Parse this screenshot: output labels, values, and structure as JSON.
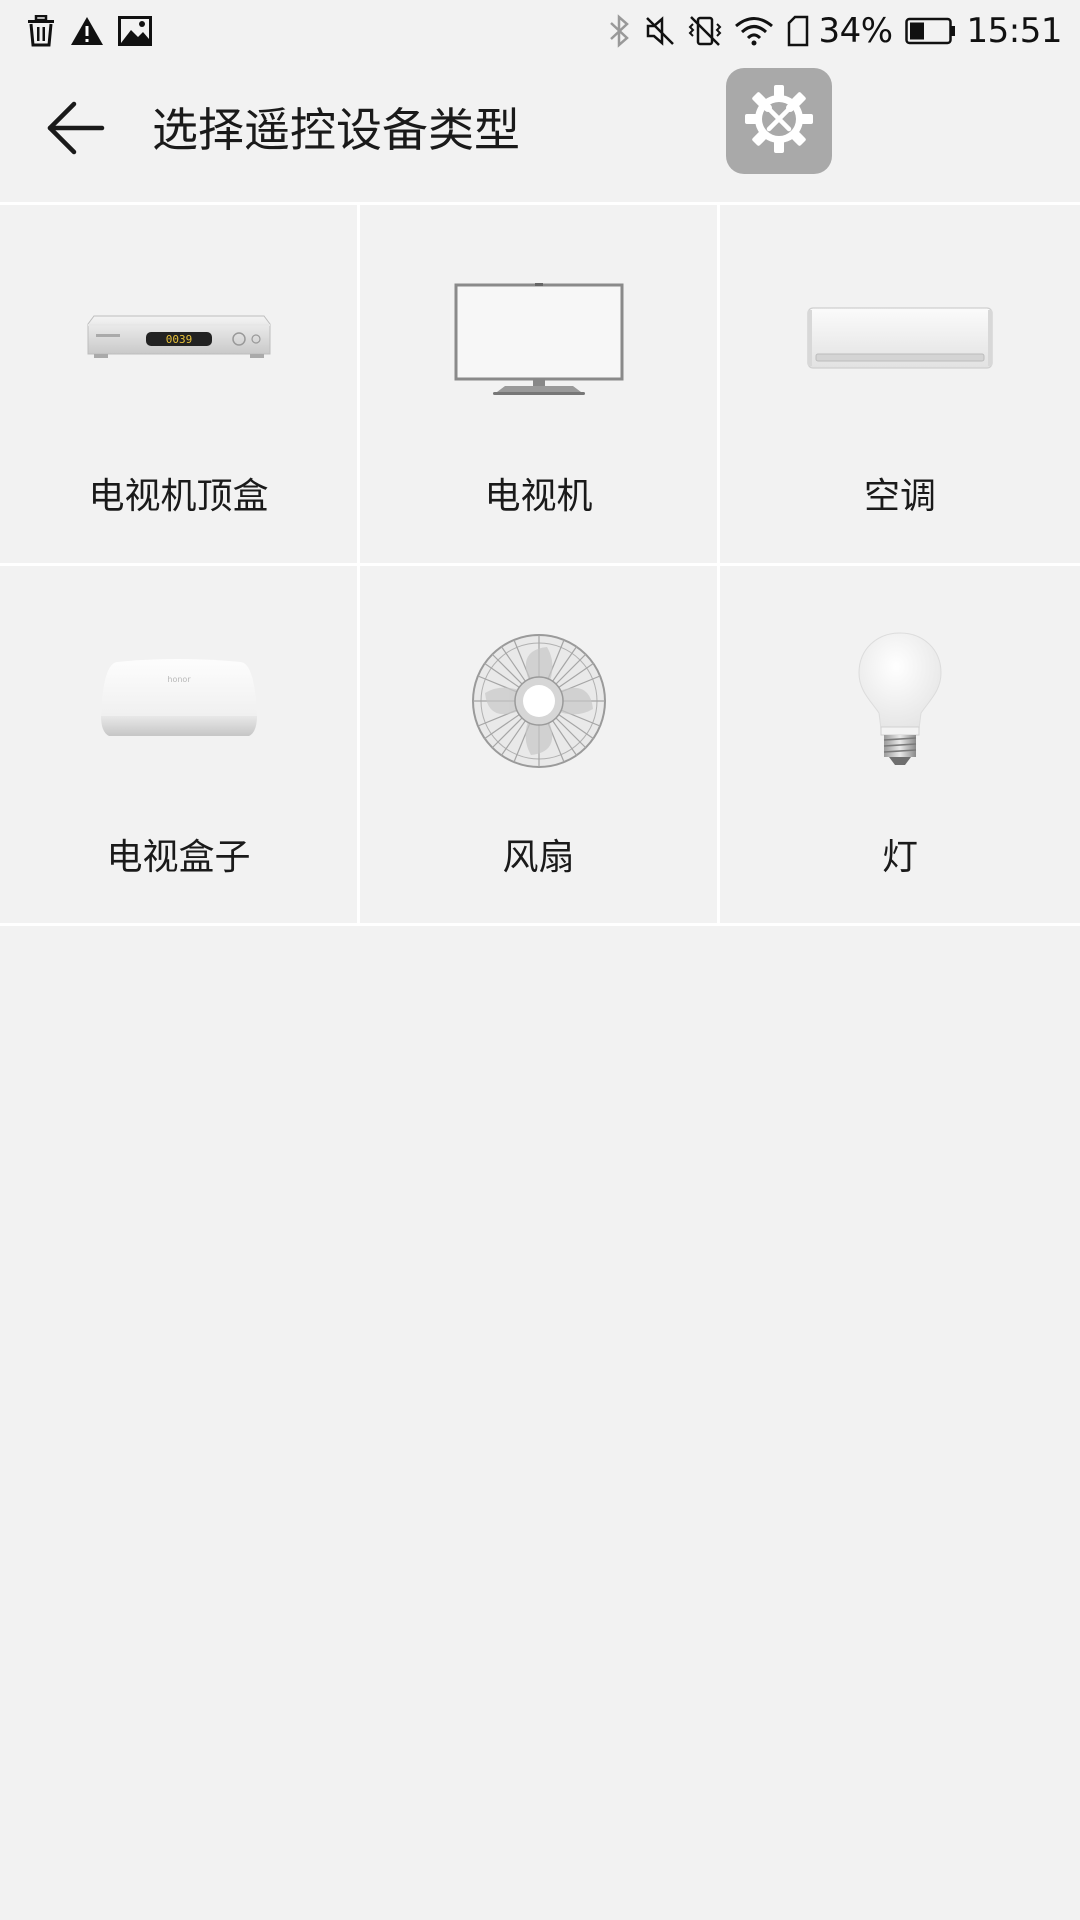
{
  "status_bar": {
    "left_icons": [
      "trash-icon",
      "warning-icon",
      "image-icon"
    ],
    "right_icons": [
      "bluetooth-icon",
      "mute-icon",
      "vibrate-off-icon",
      "wifi-icon",
      "sim-icon",
      "battery-icon"
    ],
    "battery_percent": "34%",
    "time": "15:51"
  },
  "header": {
    "title": "选择遥控设备类型",
    "back_icon": "arrow-left-icon",
    "settings_icon": "settings-tools-icon",
    "settings_color": "#a9a9a9"
  },
  "device_types": [
    {
      "label": "电视机顶盒",
      "icon": "set-top-box-icon"
    },
    {
      "label": "电视机",
      "icon": "tv-icon"
    },
    {
      "label": "空调",
      "icon": "air-conditioner-icon"
    },
    {
      "label": "电视盒子",
      "icon": "tv-box-icon"
    },
    {
      "label": "风扇",
      "icon": "fan-icon"
    },
    {
      "label": "灯",
      "icon": "light-bulb-icon"
    }
  ],
  "colors": {
    "background": "#f2f2f2",
    "divider": "#ffffff",
    "text": "#1a1a1a"
  }
}
